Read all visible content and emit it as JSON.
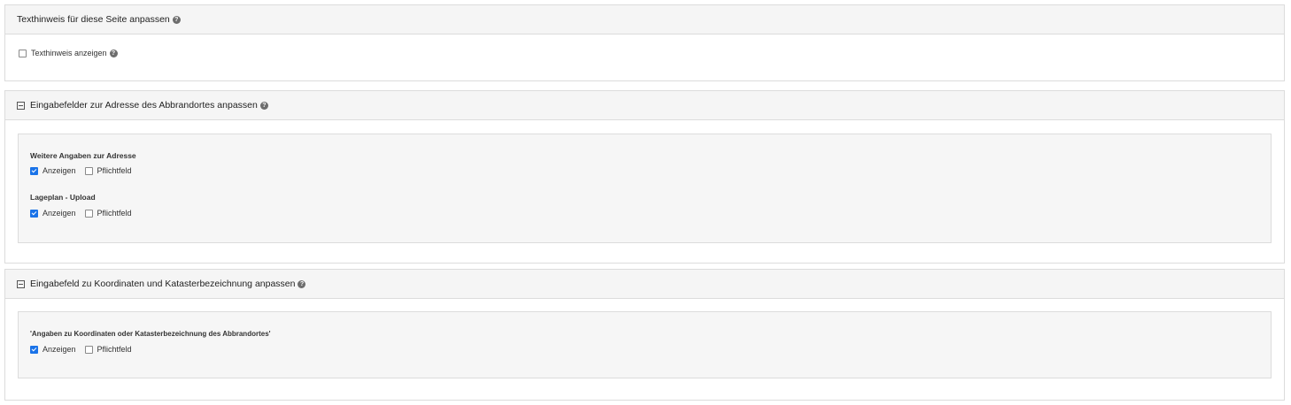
{
  "panel1": {
    "title": "Texthinweis für diese Seite anpassen",
    "checkbox_label": "Texthinweis anzeigen",
    "checkbox_checked": false
  },
  "panel2": {
    "title": "Eingabefelder zur Adresse des Abbrandortes anpassen",
    "fields": [
      {
        "title": "Weitere Angaben zur Adresse",
        "show_label": "Anzeigen",
        "show_checked": true,
        "required_label": "Pflichtfeld",
        "required_checked": false
      },
      {
        "title": "Lageplan - Upload",
        "show_label": "Anzeigen",
        "show_checked": true,
        "required_label": "Pflichtfeld",
        "required_checked": false
      }
    ]
  },
  "panel3": {
    "title": "Eingabefeld zu Koordinaten und Katasterbezeichnung anpassen",
    "fields": [
      {
        "title": "'Angaben zu Koordinaten oder Katasterbezeichnung des Abbrandortes'",
        "show_label": "Anzeigen",
        "show_checked": true,
        "required_label": "Pflichtfeld",
        "required_checked": false
      }
    ]
  },
  "help_icon_glyph": "?"
}
